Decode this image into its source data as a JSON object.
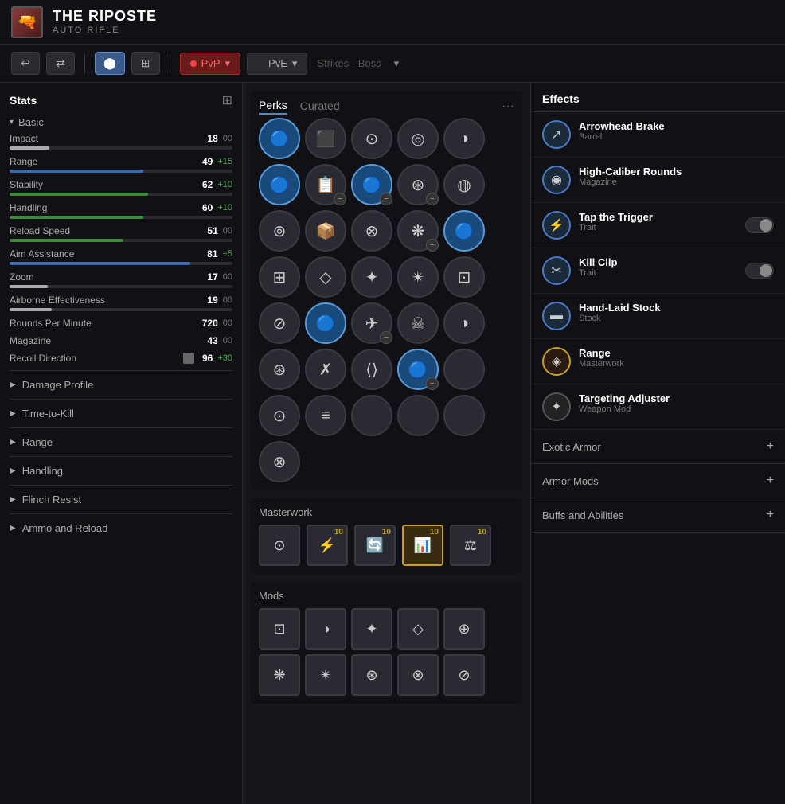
{
  "header": {
    "weapon_name": "THE RIPOSTE",
    "weapon_type": "AUTO RIFLE",
    "icon": "🔫"
  },
  "toolbar": {
    "undo_label": "↩",
    "shuffle_label": "⇄",
    "grid_label": "⊞",
    "pvp_label": "PvP",
    "pve_label": "PvE",
    "strikes_label": "Strikes",
    "separator": "-",
    "boss_label": "Boss"
  },
  "stats": {
    "section_title": "Stats",
    "basic_section": "Basic",
    "items": [
      {
        "name": "Impact",
        "value": 18,
        "max": 100,
        "bonus": "00",
        "bonus_type": "neutral",
        "bar_pct": 18,
        "bar_color": "white"
      },
      {
        "name": "Range",
        "value": 49,
        "max": 100,
        "bonus": "+15",
        "bonus_type": "green",
        "bar_pct": 60,
        "bar_color": "blue"
      },
      {
        "name": "Stability",
        "value": 62,
        "max": 100,
        "bonus": "+10",
        "bonus_type": "green",
        "bar_pct": 62,
        "bar_color": "green"
      },
      {
        "name": "Handling",
        "value": 60,
        "max": 100,
        "bonus": "+10",
        "bonus_type": "green",
        "bar_pct": 60,
        "bar_color": "green"
      },
      {
        "name": "Reload Speed",
        "value": 51,
        "max": 100,
        "bonus": "00",
        "bonus_type": "neutral",
        "bar_pct": 51,
        "bar_color": "green"
      },
      {
        "name": "Aim Assistance",
        "value": 81,
        "max": 100,
        "bonus": "+5",
        "bonus_type": "green",
        "bar_pct": 81,
        "bar_color": "green"
      },
      {
        "name": "Zoom",
        "value": 17,
        "max": 100,
        "bonus": "00",
        "bonus_type": "neutral",
        "bar_pct": 17,
        "bar_color": "white"
      },
      {
        "name": "Airborne Effectiveness",
        "value": 19,
        "max": 100,
        "bonus": "00",
        "bonus_type": "neutral",
        "bar_pct": 19,
        "bar_color": "white"
      }
    ],
    "other_stats": [
      {
        "name": "Rounds Per Minute",
        "value": "720",
        "bonus": "00",
        "bonus_type": "neutral"
      },
      {
        "name": "Magazine",
        "value": "43",
        "bonus": "00",
        "bonus_type": "neutral"
      },
      {
        "name": "Recoil Direction",
        "value": "96",
        "bonus": "+30",
        "bonus_type": "green"
      }
    ],
    "collapsible_sections": [
      "Damage Profile",
      "Time-to-Kill",
      "Range",
      "Handling",
      "Flinch Resist",
      "Ammo and Reload"
    ]
  },
  "perks": {
    "tabs": [
      "Perks",
      "Curated"
    ],
    "active_tab": "Perks",
    "grid": [
      [
        "🔵",
        "⬛",
        "⬛",
        "⬛",
        "⬛"
      ],
      [
        "🔵",
        "📋",
        "🔵",
        "⬛",
        "⬛"
      ],
      [
        "⬛",
        "📦",
        "⬛",
        "⬛",
        "🔵"
      ],
      [
        "⬛",
        "⬛",
        "⬛",
        "⬛",
        "⬛"
      ],
      [
        "⬛",
        "🔵",
        "⬛",
        "⬛",
        "⬛"
      ],
      [
        "⬛",
        "⬛",
        "⬛",
        "🔵",
        "⬛"
      ],
      [
        "⬛",
        "⬛",
        "⬛",
        "⬛",
        "⬛"
      ]
    ]
  },
  "masterwork": {
    "label": "Masterwork",
    "icons": [
      {
        "symbol": "⊙",
        "active": false,
        "level": null
      },
      {
        "symbol": "⚡",
        "active": false,
        "level": "10"
      },
      {
        "symbol": "🔄",
        "active": false,
        "level": "10"
      },
      {
        "symbol": "📊",
        "active": true,
        "level": "10"
      },
      {
        "symbol": "⚖",
        "active": false,
        "level": "10"
      }
    ]
  },
  "mods": {
    "label": "Mods",
    "rows": [
      [
        {
          "symbol": "⊡",
          "active": false
        },
        {
          "symbol": "◑",
          "active": false
        },
        {
          "symbol": "✦",
          "active": false
        },
        {
          "symbol": "◇",
          "active": false
        },
        {
          "symbol": "⊕",
          "active": false
        }
      ],
      [
        {
          "symbol": "❋",
          "active": false
        },
        {
          "symbol": "✴",
          "active": false
        },
        {
          "symbol": "⊛",
          "active": false
        },
        {
          "symbol": "⊗",
          "active": false
        },
        {
          "symbol": "⊘",
          "active": false
        }
      ]
    ]
  },
  "effects": {
    "title": "Effects",
    "items": [
      {
        "name": "Arrowhead Brake",
        "subtitle": "Barrel",
        "icon": "↗",
        "icon_style": "blue-border",
        "has_toggle": false
      },
      {
        "name": "High-Caliber Rounds",
        "subtitle": "Magazine",
        "icon": "◉",
        "icon_style": "blue-border",
        "has_toggle": false
      },
      {
        "name": "Tap the Trigger",
        "subtitle": "Trait",
        "icon": "⚡",
        "icon_style": "blue-border",
        "has_toggle": true
      },
      {
        "name": "Kill Clip",
        "subtitle": "Trait",
        "icon": "✂",
        "icon_style": "blue-border",
        "has_toggle": true
      },
      {
        "name": "Hand-Laid Stock",
        "subtitle": "Stock",
        "icon": "🔵",
        "icon_style": "blue-border",
        "has_toggle": false
      },
      {
        "name": "Range",
        "subtitle": "Masterwork",
        "icon": "◈",
        "icon_style": "gold-border",
        "has_toggle": false
      },
      {
        "name": "Targeting Adjuster",
        "subtitle": "Weapon Mod",
        "icon": "✦",
        "icon_style": "default",
        "has_toggle": false
      }
    ],
    "collapsible": [
      {
        "label": "Exotic Armor"
      },
      {
        "label": "Armor Mods"
      },
      {
        "label": "Buffs and Abilities"
      }
    ]
  }
}
